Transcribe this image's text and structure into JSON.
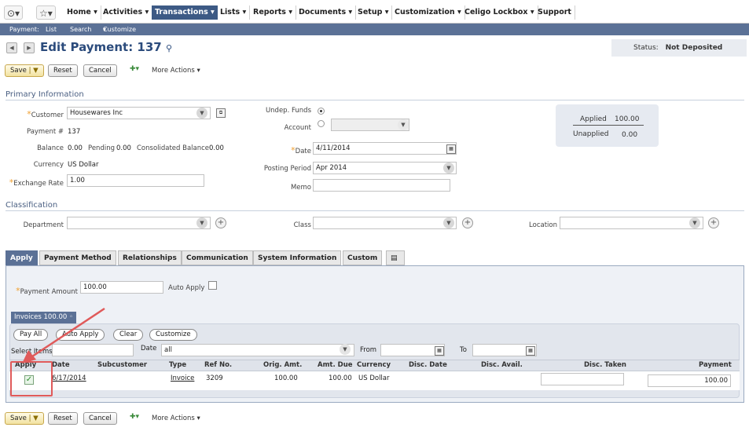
{
  "nav": {
    "items": [
      "Home",
      "Activities",
      "Transactions",
      "Lists",
      "Reports",
      "Documents",
      "Setup",
      "Customization",
      "Celigo Lockbox",
      "Support"
    ],
    "active": "Transactions"
  },
  "subnav": {
    "section": "Payment:",
    "links": [
      "List",
      "Search",
      "Customize"
    ]
  },
  "page": {
    "title": "Edit Payment: 137",
    "status_label": "Status:",
    "status_value": "Not Deposited"
  },
  "toolbar": {
    "save": "Save",
    "reset": "Reset",
    "cancel": "Cancel",
    "more_actions": "More Actions"
  },
  "primary": {
    "heading": "Primary Information",
    "customer_label": "Customer",
    "customer_value": "Housewares Inc",
    "payment_no_label": "Payment #",
    "payment_no_value": "137",
    "balance_label": "Balance",
    "balance_value": "0.00",
    "pending_label": "Pending",
    "pending_value": "0.00",
    "consolidated_label": "Consolidated Balance",
    "consolidated_value": "0.00",
    "currency_label": "Currency",
    "currency_value": "US Dollar",
    "exchange_label": "Exchange Rate",
    "exchange_value": "1.00",
    "undep_label": "Undep. Funds",
    "account_label": "Account",
    "date_label": "Date",
    "date_value": "4/11/2014",
    "posting_label": "Posting Period",
    "posting_value": "Apr 2014",
    "memo_label": "Memo",
    "applied_label": "Applied",
    "applied_value": "100.00",
    "unapplied_label": "Unapplied",
    "unapplied_value": "0.00"
  },
  "classification": {
    "heading": "Classification",
    "department_label": "Department",
    "class_label": "Class",
    "location_label": "Location"
  },
  "tabs": [
    "Apply",
    "Payment Method",
    "Relationships",
    "Communication",
    "System Information",
    "Custom"
  ],
  "apply": {
    "payment_amount_label": "Payment Amount",
    "payment_amount_value": "100.00",
    "auto_apply_label": "Auto Apply",
    "invoices_tab": "Invoices 100.00",
    "buttons": [
      "Pay All",
      "Auto Apply",
      "Clear",
      "Customize"
    ],
    "select_items_label": "Select Items",
    "date_label": "Date",
    "date_value": "all",
    "from_label": "From",
    "to_label": "To",
    "columns": [
      "Apply",
      "Date",
      "Subcustomer",
      "Type",
      "Ref No.",
      "Orig. Amt.",
      "Amt. Due",
      "Currency",
      "Disc. Date",
      "Disc. Avail.",
      "Disc. Taken",
      "Payment"
    ],
    "row": {
      "applied": true,
      "date": "6/17/2014",
      "subcustomer": "",
      "type": "Invoice",
      "ref_no": "3209",
      "orig_amt": "100.00",
      "amt_due": "100.00",
      "currency": "US Dollar",
      "disc_date": "",
      "disc_avail": "",
      "disc_taken": "",
      "payment": "100.00"
    }
  },
  "colors": {
    "nav_active": "#3d5a85",
    "accent": "#2b4b7c",
    "annotation": "#e05a5a"
  }
}
